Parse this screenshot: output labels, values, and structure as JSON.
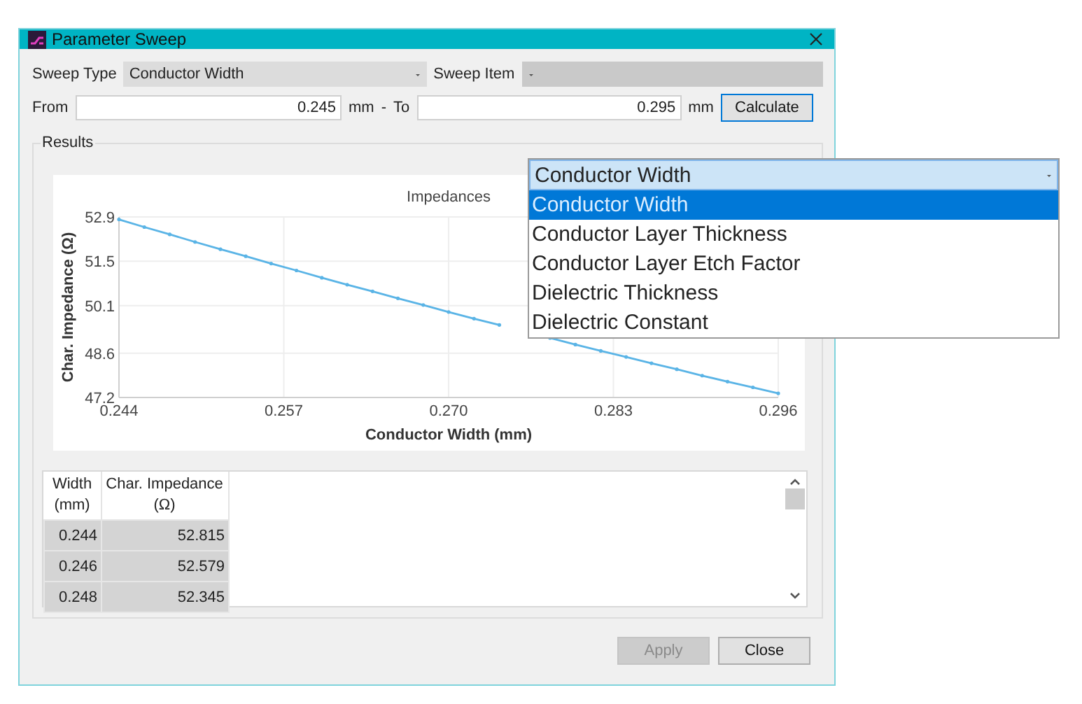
{
  "window": {
    "title": "Parameter Sweep"
  },
  "sweep_type": {
    "label": "Sweep Type",
    "value": "Conductor Width"
  },
  "sweep_item": {
    "label": "Sweep Item",
    "disabled": true
  },
  "range": {
    "from_label": "From",
    "from_value": "0.245",
    "from_unit": "mm",
    "separator": "-",
    "to_label": "To",
    "to_value": "0.295",
    "to_unit": "mm"
  },
  "calculate_button": "Calculate",
  "results": {
    "title": "Results",
    "chart_data": {
      "type": "line",
      "title": "Impedances",
      "xlabel": "Conductor Width (mm)",
      "ylabel": "Char. Impedance (Ω)",
      "x": [
        0.244,
        0.246,
        0.248,
        0.25,
        0.252,
        0.254,
        0.256,
        0.258,
        0.26,
        0.262,
        0.264,
        0.266,
        0.268,
        0.27,
        0.272,
        0.274,
        0.276,
        0.278,
        0.28,
        0.282,
        0.284,
        0.286,
        0.288,
        0.29,
        0.292,
        0.294,
        0.296
      ],
      "series": [
        {
          "color": "#5ab4e6",
          "values": [
            52.82,
            52.58,
            52.35,
            52.11,
            51.88,
            51.66,
            51.43,
            51.21,
            50.98,
            50.76,
            50.55,
            50.33,
            50.12,
            49.9,
            49.69,
            49.49,
            null,
            49.08,
            48.87,
            48.67,
            48.48,
            48.28,
            48.09,
            47.89,
            47.7,
            47.52,
            47.33
          ]
        }
      ],
      "grid": true,
      "xlim": [
        0.244,
        0.296
      ],
      "ylim": [
        47.2,
        52.9
      ],
      "xticks": [
        {
          "value": 0.244,
          "label": "0.244"
        },
        {
          "value": 0.257,
          "label": "0.257"
        },
        {
          "value": 0.27,
          "label": "0.270"
        },
        {
          "value": 0.283,
          "label": "0.283"
        },
        {
          "value": 0.296,
          "label": "0.296"
        }
      ],
      "yticks": [
        52.9,
        51.5,
        50.1,
        48.6,
        47.2
      ]
    },
    "table": {
      "columns": [
        "Width (mm)",
        "Char. Impedance (Ω)"
      ],
      "rows": [
        [
          "0.244",
          "52.815"
        ],
        [
          "0.246",
          "52.579"
        ],
        [
          "0.248",
          "52.345"
        ]
      ]
    }
  },
  "buttons": [
    {
      "label": "Apply",
      "disabled": true
    },
    {
      "label": "Close",
      "disabled": false
    }
  ],
  "dropdown": {
    "value": "Conductor Width",
    "options": [
      {
        "label": "Conductor Width",
        "selected": true
      },
      {
        "label": "Conductor Layer Thickness",
        "selected": false
      },
      {
        "label": "Conductor Layer Etch Factor",
        "selected": false
      },
      {
        "label": "Dielectric Thickness",
        "selected": false
      },
      {
        "label": "Dielectric Constant",
        "selected": false
      }
    ]
  }
}
